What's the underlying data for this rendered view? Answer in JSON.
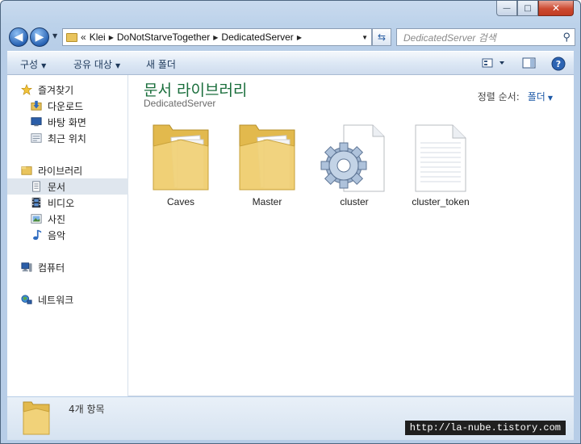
{
  "window": {
    "minimize": "—",
    "maximize": "□",
    "close": "✕"
  },
  "nav": {
    "breadcrumb": [
      "Klei",
      "DoNotStarveTogether",
      "DedicatedServer"
    ],
    "overflow": "«",
    "search_placeholder": "DedicatedServer 검색"
  },
  "toolbar": {
    "organize": "구성",
    "share": "공유 대상",
    "new_folder": "새 폴더"
  },
  "sidebar": {
    "favorites": {
      "label": "즐겨찾기",
      "items": [
        "다운로드",
        "바탕 화면",
        "최근 위치"
      ]
    },
    "libraries": {
      "label": "라이브러리",
      "items": [
        "문서",
        "비디오",
        "사진",
        "음악"
      ]
    },
    "computer": "컴퓨터",
    "network": "네트워크"
  },
  "main": {
    "title": "문서 라이브러리",
    "subtitle": "DedicatedServer",
    "sort_label": "정렬 순서:",
    "sort_value": "폴더",
    "items": [
      {
        "name": "Caves",
        "icon": "folder-icon"
      },
      {
        "name": "Master",
        "icon": "folder-icon"
      },
      {
        "name": "cluster",
        "icon": "settings-file-icon"
      },
      {
        "name": "cluster_token",
        "icon": "text-file-icon"
      }
    ]
  },
  "status": {
    "item_count": "4개 항목"
  },
  "watermark": "http://la-nube.tistory.com",
  "colors": {
    "title_green": "#1a6e3c",
    "link_blue": "#1e5aa8",
    "selection": "#dfe6ee"
  }
}
